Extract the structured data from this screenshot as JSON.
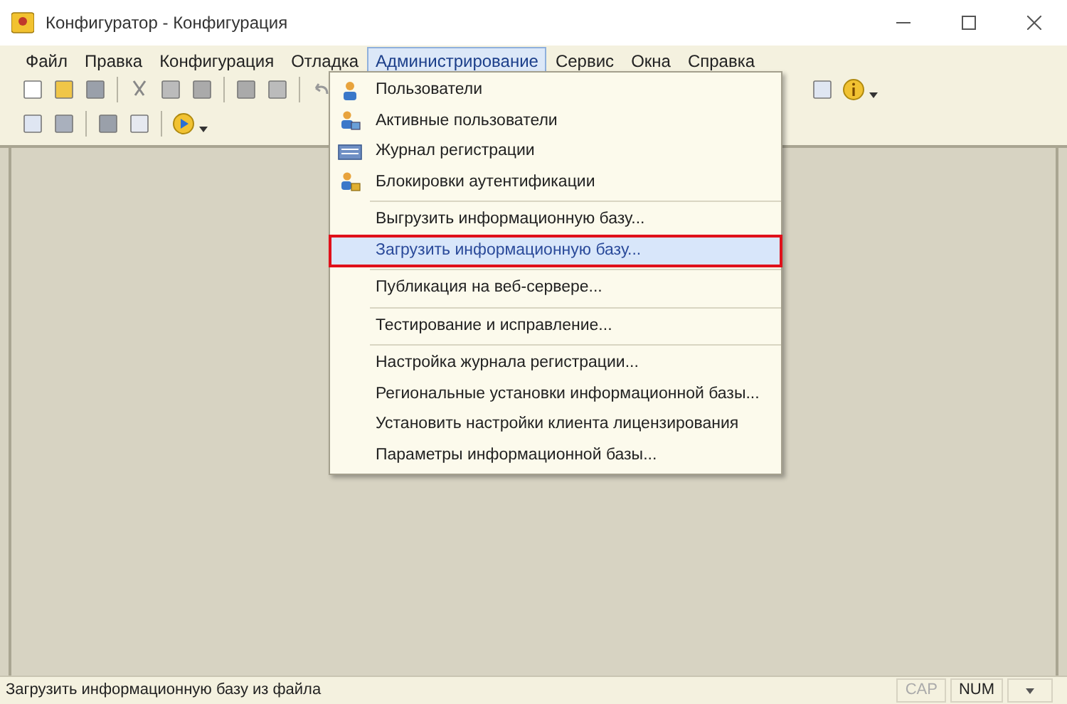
{
  "window": {
    "title": "Конфигуратор - Конфигурация"
  },
  "menu_bar": [
    {
      "label": "Файл",
      "selected": false
    },
    {
      "label": "Правка",
      "selected": false
    },
    {
      "label": "Конфигурация",
      "selected": false
    },
    {
      "label": "Отладка",
      "selected": false
    },
    {
      "label": "Администрирование",
      "selected": true
    },
    {
      "label": "Сервис",
      "selected": false
    },
    {
      "label": "Окна",
      "selected": false
    },
    {
      "label": "Справка",
      "selected": false
    }
  ],
  "dropdown": {
    "groups": [
      [
        {
          "label": "Пользователи",
          "kind": "user",
          "selected": false
        },
        {
          "label": "Активные пользователи",
          "kind": "users",
          "selected": false
        },
        {
          "label": "Журнал регистрации",
          "kind": "log",
          "selected": false
        },
        {
          "label": "Блокировки аутентификации",
          "kind": "lock",
          "selected": false
        }
      ],
      [
        {
          "label": "Выгрузить информационную базу...",
          "kind": "plain",
          "selected": false
        },
        {
          "label": "Загрузить информационную базу...",
          "kind": "plain",
          "selected": true
        }
      ],
      [
        {
          "label": "Публикация на веб-сервере...",
          "kind": "plain",
          "selected": false
        }
      ],
      [
        {
          "label": "Тестирование и исправление...",
          "kind": "plain",
          "selected": false
        }
      ],
      [
        {
          "label": "Настройка журнала регистрации...",
          "kind": "plain",
          "selected": false
        },
        {
          "label": "Региональные установки информационной базы...",
          "kind": "plain",
          "selected": false
        },
        {
          "label": "Установить настройки клиента лицензирования",
          "kind": "plain",
          "selected": false
        },
        {
          "label": "Параметры информационной базы...",
          "kind": "plain",
          "selected": false
        }
      ]
    ]
  },
  "status_bar": {
    "message": "Загрузить информационную базу из файла",
    "indicators": [
      {
        "label": "CAP",
        "disabled": true
      },
      {
        "label": "NUM",
        "disabled": false
      }
    ]
  }
}
